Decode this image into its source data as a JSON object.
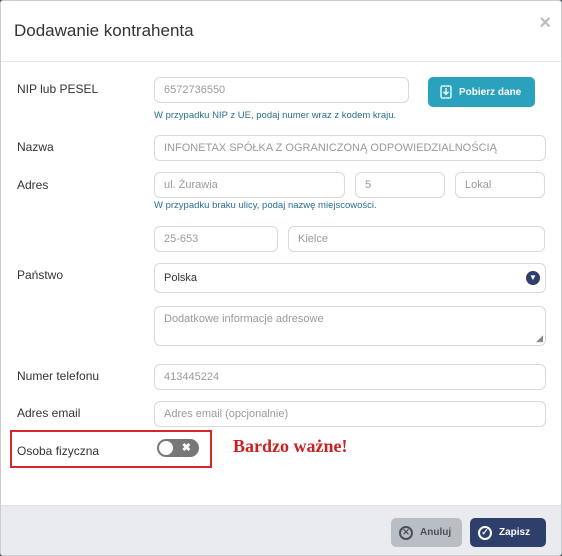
{
  "header": {
    "title": "Dodawanie kontrahenta",
    "close_icon": "×"
  },
  "nip": {
    "label": "NIP lub PESEL",
    "value": "6572736550",
    "hint": "W przypadku NIP z UE, podaj numer wraz z kodem kraju.",
    "fetch_button": "Pobierz dane"
  },
  "name": {
    "label": "Nazwa",
    "value": "INFONETAX SPÓŁKA Z OGRANICZONĄ ODPOWIEDZIALNOŚCIĄ"
  },
  "address": {
    "label": "Adres",
    "street_placeholder": "ul. Żurawia",
    "building": "5",
    "unit_placeholder": "Lokal",
    "hint": "W przypadku braku ulicy, podaj nazwę miejscowości.",
    "postal_code": "25-653",
    "city": "Kielce"
  },
  "country": {
    "label": "Państwo",
    "selected": "Polska"
  },
  "additional_address": {
    "placeholder": "Dodatkowe informacje adresowe"
  },
  "phone": {
    "label": "Numer telefonu",
    "value": "413445224"
  },
  "email": {
    "label": "Adres email",
    "placeholder": "Adres email (opcjonalnie)"
  },
  "natural_person": {
    "label": "Osoba fizyczna",
    "enabled": false
  },
  "annotation": "Bardzo ważne!",
  "footer": {
    "cancel": "Anuluj",
    "save": "Zapisz"
  },
  "colors": {
    "accent": "#2aa1bd",
    "primary": "#2f3f6b",
    "hint_text": "#2a6f8f",
    "annotation": "#cc1f1f"
  }
}
